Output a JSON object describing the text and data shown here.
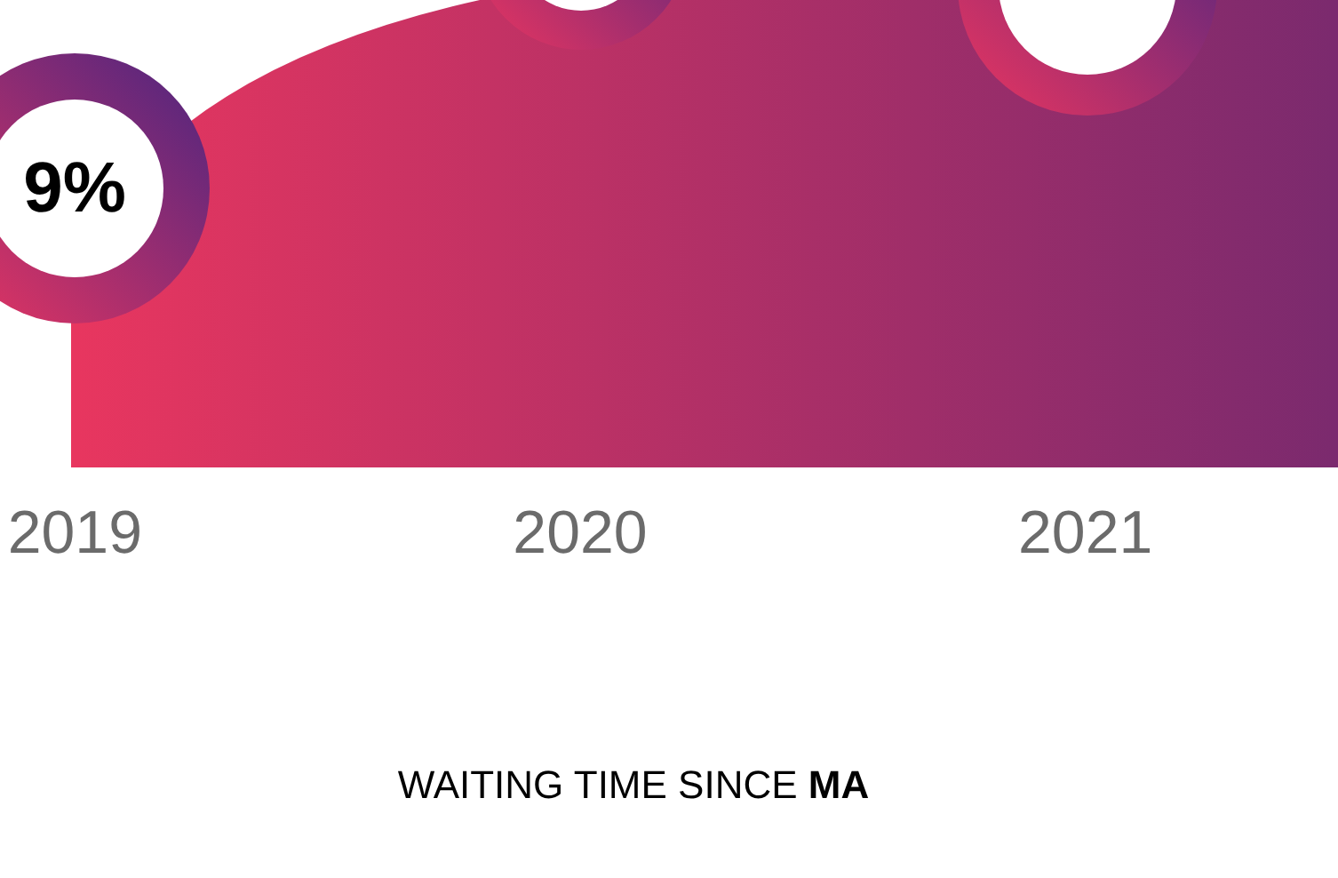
{
  "chart": {
    "points": [
      {
        "year": "2019",
        "value": "9%"
      },
      {
        "year": "2020"
      },
      {
        "year": "2021"
      }
    ]
  },
  "caption": "WAITING TIME SINCE **MA**"
}
